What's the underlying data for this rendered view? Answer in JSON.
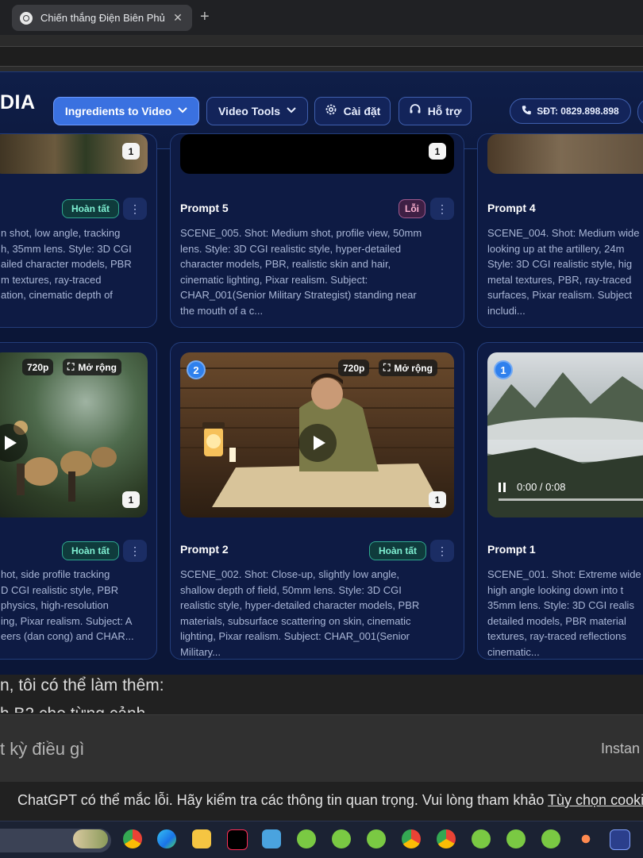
{
  "browser": {
    "tab_title": "Chiến thắng Điện Biên Phủ",
    "close_glyph": "✕",
    "new_tab_glyph": "+"
  },
  "header": {
    "logo": "DIA",
    "nav": [
      {
        "label": "Ingredients to Video",
        "icon": "chevron-down-icon"
      },
      {
        "label": "Video Tools",
        "icon": "chevron-down-icon"
      },
      {
        "label": "Cài đặt",
        "icon": "gear-icon"
      },
      {
        "label": "Hỗ trợ",
        "icon": "headset-icon"
      }
    ],
    "phone": "SĐT: 0829.898.898"
  },
  "cards_top": [
    {
      "title": "",
      "status": "Hoàn tất",
      "desc": "n shot, low angle, tracking\nh, 35mm lens. Style: 3D CGI\nailed character models, PBR\nm textures, ray-traced\nation, cinematic depth of",
      "count": "1"
    },
    {
      "title": "Prompt 5",
      "status": "Lỗi",
      "desc": "SCENE_005. Shot: Medium shot, profile view, 50mm\nlens. Style: 3D CGI realistic style, hyper-detailed\ncharacter models, PBR, realistic skin and hair,\ncinematic lighting, Pixar realism. Subject:\nCHAR_001(Senior Military Strategist) standing near\nthe mouth of a c...",
      "count": "1"
    },
    {
      "title": "Prompt 4",
      "status": "",
      "desc": "SCENE_004. Shot: Medium wide\nlooking up at the artillery, 24m\nStyle: 3D CGI realistic style, hig\nmetal textures, PBR, ray-traced\nsurfaces, Pixar realism. Subject\nincludi...",
      "count": ""
    }
  ],
  "cards_bottom": [
    {
      "title": "",
      "status": "Hoàn tất",
      "desc": "hot, side profile tracking\nD CGI realistic style, PBR\nphysics, high-resolution\ning, Pixar realism. Subject: A\neers (dan cong) and CHAR...",
      "count": "1",
      "quality": "720p",
      "expand": "Mở rộng"
    },
    {
      "title": "Prompt 2",
      "status": "Hoàn tất",
      "desc": "SCENE_002. Shot: Close-up, slightly low angle,\nshallow depth of field, 50mm lens. Style: 3D CGI\nrealistic style, hyper-detailed character models, PBR\nmaterials, subsurface scattering on skin, cinematic\nlighting, Pixar realism. Subject: CHAR_001(Senior\nMilitary...",
      "count": "1",
      "quality": "720p",
      "expand": "Mở rộng",
      "badge": "2"
    },
    {
      "title": "Prompt 1",
      "status": "",
      "desc": "SCENE_001. Shot: Extreme wide\nhigh angle looking down into t\n35mm lens. Style: 3D CGI realis\ndetailed models, PBR material\ntextures, ray-traced reflections\ncinematic...",
      "count": "",
      "badge": "1",
      "time": "0:00 / 0:08"
    }
  ],
  "chat": {
    "line1": "n, tôi có thể làm thêm:",
    "line2": "h B2 cho từng cảnh",
    "placeholder": "t kỳ điều gì",
    "mode": "Instan",
    "disclaimer": "ChatGPT có thể mắc lỗi. Hãy kiểm tra các thông tin quan trọng. Vui lòng tham khảo ",
    "disclaimer_link": "Tùy chọn cookie"
  },
  "colors": {
    "app_bg": "#0b1637",
    "primary": "#3a71e0",
    "ok": "#7ff0d2",
    "err": "#ffb3d2"
  }
}
